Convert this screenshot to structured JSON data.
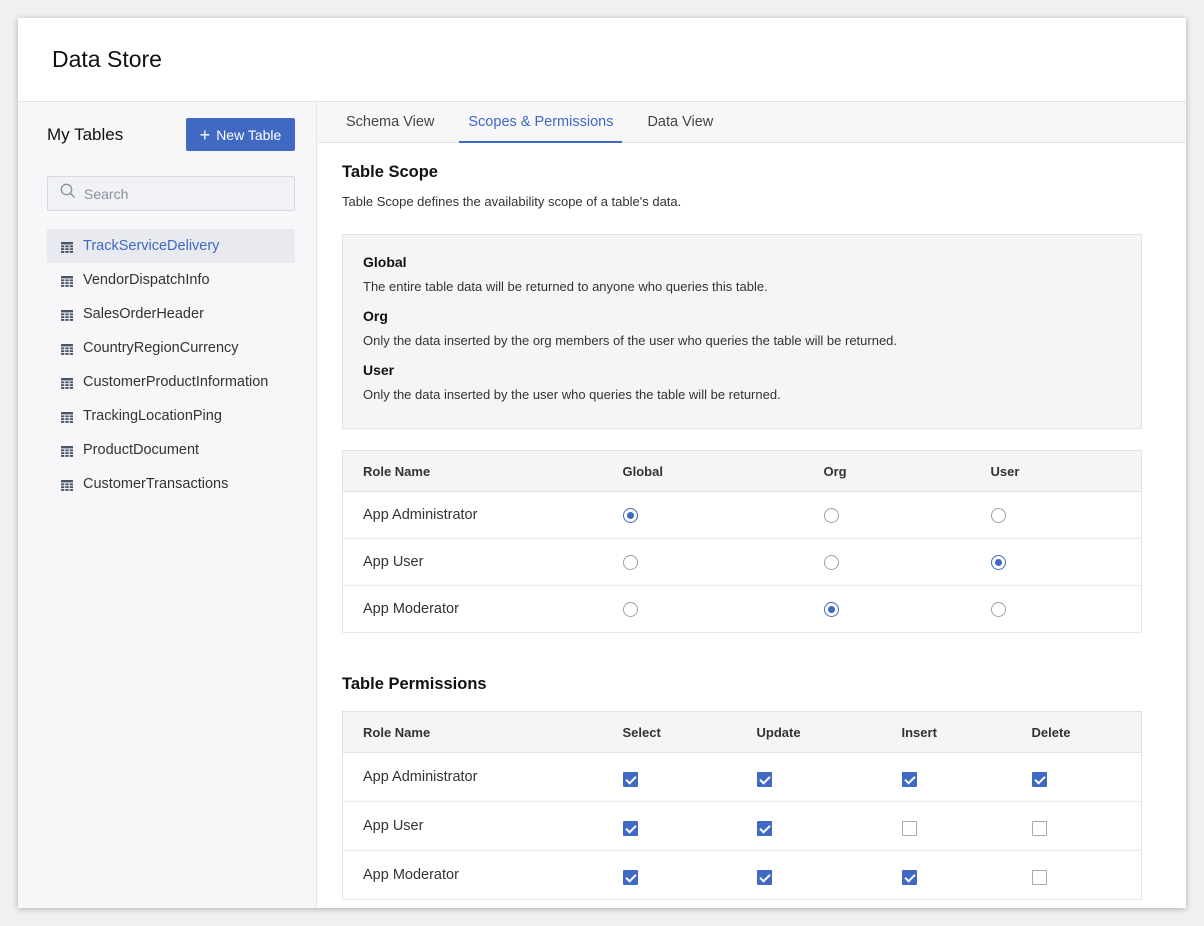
{
  "header": {
    "title": "Data Store"
  },
  "sidebar": {
    "title": "My Tables",
    "new_table_label": "New Table",
    "search_placeholder": "Search",
    "tables": [
      {
        "label": "TrackServiceDelivery",
        "active": true
      },
      {
        "label": "VendorDispatchInfo",
        "active": false
      },
      {
        "label": "SalesOrderHeader",
        "active": false
      },
      {
        "label": "CountryRegionCurrency",
        "active": false
      },
      {
        "label": "CustomerProductInformation",
        "active": false
      },
      {
        "label": "TrackingLocationPing",
        "active": false
      },
      {
        "label": "ProductDocument",
        "active": false
      },
      {
        "label": "CustomerTransactions",
        "active": false
      }
    ]
  },
  "tabs": [
    {
      "label": "Schema View",
      "active": false
    },
    {
      "label": "Scopes & Permissions",
      "active": true
    },
    {
      "label": "Data View",
      "active": false
    }
  ],
  "scope_section": {
    "title": "Table Scope",
    "description": "Table Scope defines the availability scope of a table's data.",
    "definitions": [
      {
        "name": "Global",
        "description": "The entire table data will be returned to anyone who queries this table."
      },
      {
        "name": "Org",
        "description": "Only the data inserted by the org members of the user who queries the table will be returned."
      },
      {
        "name": "User",
        "description": "Only the data inserted by the user who queries the table will be returned."
      }
    ],
    "table": {
      "headers": [
        "Role Name",
        "Global",
        "Org",
        "User"
      ],
      "rows": [
        {
          "role": "App Administrator",
          "selected": "Global"
        },
        {
          "role": "App User",
          "selected": "User"
        },
        {
          "role": "App Moderator",
          "selected": "Org"
        }
      ]
    }
  },
  "permissions_section": {
    "title": "Table Permissions",
    "table": {
      "headers": [
        "Role Name",
        "Select",
        "Update",
        "Insert",
        "Delete"
      ],
      "rows": [
        {
          "role": "App Administrator",
          "select": true,
          "update": true,
          "insert": true,
          "delete": true
        },
        {
          "role": "App User",
          "select": true,
          "update": true,
          "insert": false,
          "delete": false
        },
        {
          "role": "App Moderator",
          "select": true,
          "update": true,
          "insert": true,
          "delete": false
        }
      ]
    }
  },
  "colors": {
    "accent": "#3f69c2",
    "sidebar_bg": "#f7f7f9",
    "panel_bg": "#f4f5f7"
  }
}
